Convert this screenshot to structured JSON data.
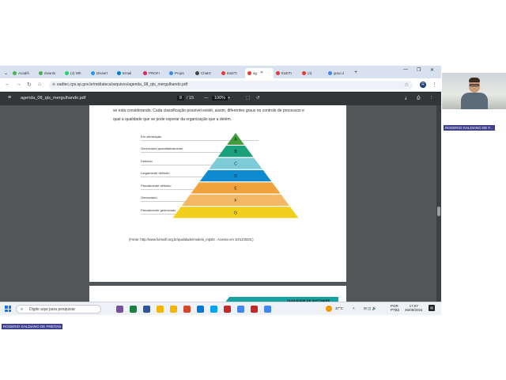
{
  "browser": {
    "tabs": [
      {
        "label": "Acadêi",
        "color": "#4caf50"
      },
      {
        "label": "downlo",
        "color": "#4caf50"
      },
      {
        "label": "(4) Wh",
        "color": "#25d366"
      },
      {
        "label": "Dissert",
        "color": "#2196f3"
      },
      {
        "label": "Email",
        "color": "#0078d4"
      },
      {
        "label": "PROFI",
        "color": "#e91e63"
      },
      {
        "label": "Projet",
        "color": "#4285f4"
      },
      {
        "label": "ChatG",
        "color": "#444444"
      },
      {
        "label": "EaDTI",
        "color": "#e53935"
      },
      {
        "label": "ag",
        "color": "#e53935",
        "active": true
      },
      {
        "label": "EaDTI",
        "color": "#e53935"
      },
      {
        "label": "(4)",
        "color": "#e53935"
      },
      {
        "label": "grau d",
        "color": "#4285f4"
      }
    ],
    "url": "eadtec.cps.sp.gov.br/midiateca/arquivos/agenda_08_qts_mergulhando.pdf",
    "profile_initial": "R"
  },
  "pdf": {
    "filename": "agenda_08_qts_mergulhando.pdf",
    "page_current": "8",
    "page_total": "/ 15",
    "zoom": "100%",
    "text_line_1": "se esta considerando. Cada classificação possível existir, assim, diferentes graus no controle de processos e",
    "text_line_2": "qual a qualidade que se pode esperar da organização que a detém.",
    "levels": [
      {
        "name": "Em otimização",
        "letter": "A",
        "color": "#3f9e3a"
      },
      {
        "name": "Gerenciado quantitativamente",
        "letter": "B",
        "color": "#1aa07a"
      },
      {
        "name": "Definido",
        "letter": "C",
        "color": "#7ecbd8"
      },
      {
        "name": "Largamente definido",
        "letter": "D",
        "color": "#0d8ad0"
      },
      {
        "name": "Parcialmente definido",
        "letter": "E",
        "color": "#f2a23a"
      },
      {
        "name": "Gerenciado",
        "letter": "F",
        "color": "#f3b968"
      },
      {
        "name": "Parcialmente gerenciado",
        "letter": "G",
        "color": "#f2cf1c"
      }
    ],
    "source": "(Fonte: http://www.fumsoft.org.br/qualidade/modelo_mpsbr . Acesso em 10/12/2020.)",
    "next_page_banner": "QUALIDADE DE SOFTWARE"
  },
  "taskbar": {
    "search_placeholder": "Digite aqui para pesquisar",
    "weather": "37°C",
    "lang_top": "POR",
    "lang_bottom": "PTB2",
    "time": "17:07",
    "date": "26/09/2024",
    "apps": [
      "#7b4fa0",
      "#1e7e45",
      "#2b579a",
      "#f4b400",
      "#f4b400",
      "#d24726",
      "#0078d4",
      "#00a4ef",
      "#c62828",
      "#4285f4",
      "#c62828",
      "#4285f4"
    ]
  },
  "meeting": {
    "presenter_badge": "ROGERIO GALDIANO DE FREITAS",
    "camera_badge": "ROGERIO GALDIANO DE F..."
  }
}
